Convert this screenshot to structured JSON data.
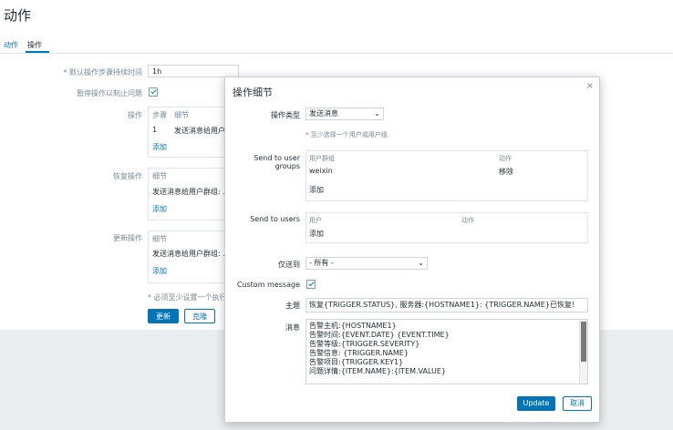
{
  "page": {
    "title": "动作",
    "tabs": [
      "动作",
      "操作"
    ]
  },
  "background": {
    "default_step_label": "* 默认操作步骤持续时间",
    "default_step_value": "1h",
    "pause_label": "暂停操作以制止问题",
    "operations_label": "操作",
    "operations_headers": [
      "步骤",
      "细节"
    ],
    "operations_row": {
      "step": "1",
      "detail": "发送消息给用户..."
    },
    "add_label": "添加",
    "recovery_label": "恢复操作",
    "recovery_header": "细节",
    "recovery_detail": "发送消息给用户群组: ...",
    "update_ops_label": "更新操作",
    "update_ops_header": "细节",
    "update_ops_detail": "发送消息给用户群组: ...",
    "footnote": "* 必须至少设置一个执行...",
    "update_button": "更新",
    "clone_button": "克隆"
  },
  "modal": {
    "title": "操作细节",
    "close_icon": "×",
    "op_type_label": "操作类型",
    "op_type_value": "发送消息",
    "note": "至少选择一个用户或用户组.",
    "note_star": "*",
    "user_groups_label": "Send to user groups",
    "user_groups_headers": {
      "group": "用户群组",
      "action": "动作"
    },
    "user_groups_rows": [
      {
        "group": "weixin",
        "action": "移除"
      }
    ],
    "users_label": "Send to users",
    "users_headers": {
      "user": "用户",
      "action": "动作"
    },
    "add_label": "添加",
    "send_only_to_label": "仅送到",
    "send_only_to_value": "- 所有 -",
    "custom_message_label": "Custom message",
    "subject_label": "主题",
    "subject_value": "恢复{TRIGGER.STATUS}, 服务器:{HOSTNAME1}: {TRIGGER.NAME}已恢复!",
    "message_label": "消息",
    "message_lines": [
      "告警主机:{HOSTNAME1}",
      "告警时间:{EVENT.DATE} {EVENT.TIME}",
      "告警等级:{TRIGGER.SEVERITY}",
      "告警信息: {TRIGGER.NAME}",
      "告警项目:{TRIGGER.KEY1}",
      "问题详情:{ITEM.NAME}:{ITEM.VALUE}"
    ],
    "update_button": "Update",
    "cancel_button": "取消"
  }
}
